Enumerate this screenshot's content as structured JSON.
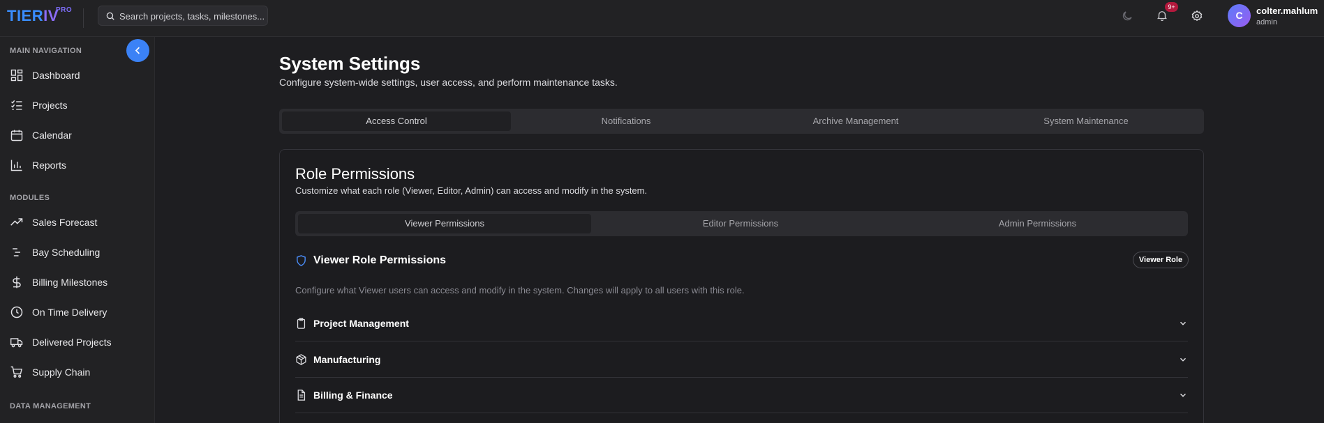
{
  "brand": {
    "name_part1": "TIER",
    "name_part2": "IV",
    "tag": "PRO"
  },
  "search": {
    "placeholder": "Search projects, tasks, milestones..."
  },
  "topbar": {
    "notification_count": "9+",
    "user": {
      "initial": "C",
      "name": "colter.mahlum",
      "role": "admin"
    }
  },
  "sidebar": {
    "sections": [
      {
        "label": "MAIN NAVIGATION",
        "items": [
          {
            "label": "Dashboard",
            "icon": "dashboard-icon"
          },
          {
            "label": "Projects",
            "icon": "checklist-icon"
          },
          {
            "label": "Calendar",
            "icon": "calendar-icon"
          },
          {
            "label": "Reports",
            "icon": "bar-chart-icon"
          }
        ]
      },
      {
        "label": "MODULES",
        "items": [
          {
            "label": "Sales Forecast",
            "icon": "trending-up-icon"
          },
          {
            "label": "Bay Scheduling",
            "icon": "schedule-lines-icon"
          },
          {
            "label": "Billing Milestones",
            "icon": "dollar-icon"
          },
          {
            "label": "On Time Delivery",
            "icon": "clock-icon"
          },
          {
            "label": "Delivered Projects",
            "icon": "truck-icon"
          },
          {
            "label": "Supply Chain",
            "icon": "cart-icon"
          }
        ]
      },
      {
        "label": "DATA MANAGEMENT",
        "items": []
      }
    ]
  },
  "page": {
    "title": "System Settings",
    "subtitle": "Configure system-wide settings, user access, and perform maintenance tasks.",
    "tabs": [
      "Access Control",
      "Notifications",
      "Archive Management",
      "System Maintenance"
    ],
    "active_tab": "Access Control"
  },
  "role_permissions": {
    "title": "Role Permissions",
    "subtitle": "Customize what each role (Viewer, Editor, Admin) can access and modify in the system.",
    "tabs": [
      "Viewer Permissions",
      "Editor Permissions",
      "Admin Permissions"
    ],
    "active_tab": "Viewer Permissions",
    "viewer": {
      "title": "Viewer Role Permissions",
      "badge": "Viewer Role",
      "description": "Configure what Viewer users can access and modify in the system. Changes will apply to all users with this role.",
      "categories": [
        {
          "label": "Project Management",
          "icon": "clipboard-icon"
        },
        {
          "label": "Manufacturing",
          "icon": "box-icon"
        },
        {
          "label": "Billing & Finance",
          "icon": "document-icon"
        }
      ]
    }
  },
  "colors": {
    "accent": "#3b82f6",
    "background": "#1e1e21",
    "badge": "#b3193d"
  }
}
